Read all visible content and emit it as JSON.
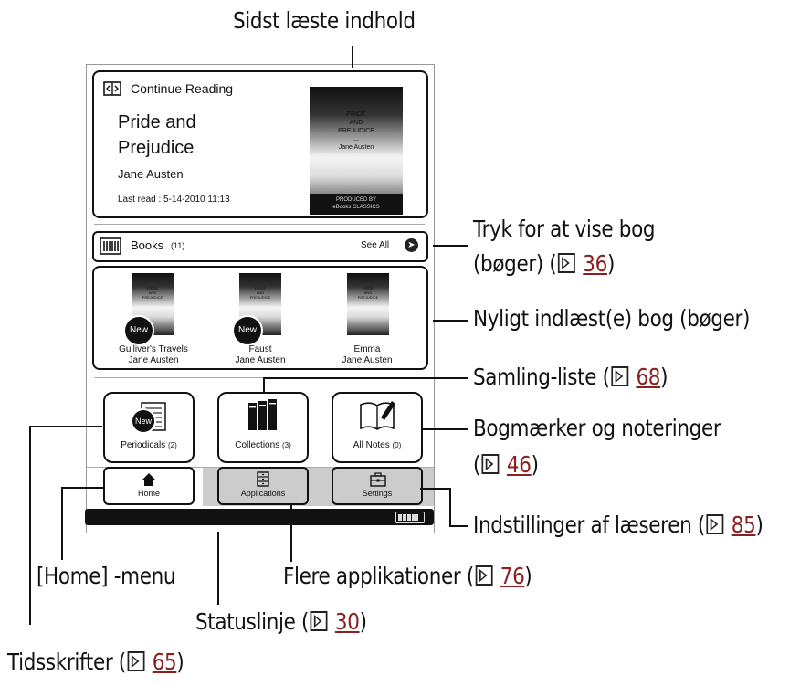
{
  "callouts": {
    "recent_content": "Sidst læste indhold",
    "tap_books_a": "Tryk for at vise bog",
    "tap_books_b": "(bøger) (",
    "tap_books_ref": "36",
    "new_books": "Nyligt indlæst(e) bog (bøger)",
    "collection_list": "Samling-liste (",
    "collection_ref": "68",
    "bookmarks_a": "Bogmærker og noteringer",
    "bookmarks_b": "(",
    "bookmarks_ref": "46",
    "settings": "Indstillinger af læseren (",
    "settings_ref": "85",
    "home_menu": "[Home] -menu",
    "more_apps": "Flere applikationer (",
    "more_apps_ref": "76",
    "status_line": "Statuslinje (",
    "status_ref": "30",
    "periodicals": "Tidsskrifter (",
    "periodicals_ref": "65",
    "close_paren": ")"
  },
  "continue_reading": {
    "label": "Continue Reading",
    "title_line1": "Pride and",
    "title_line2": "Prejudice",
    "author": "Jane Austen",
    "last_read": "Last read : 5-14-2010 11:13",
    "cover_lines": [
      "PRIDE",
      "AND",
      "PREJUDICE",
      "...",
      "Jane Austen"
    ],
    "cover_footer_1": "PRODUCED BY",
    "cover_footer_2": "eBooks CLASSICS"
  },
  "books_bar": {
    "label": "Books",
    "count": "(11)",
    "see_all": "See All"
  },
  "recent_books": [
    {
      "title": "Gulliver's Travels",
      "author": "Jane Austen",
      "badge": "New"
    },
    {
      "title": "Faust",
      "author": "Jane Austen",
      "badge": "New"
    },
    {
      "title": "Emma",
      "author": "Jane Austen",
      "badge": ""
    }
  ],
  "mini_cover_lines": [
    "PRIDE",
    "AND",
    "PREJUDICE",
    "...",
    "Jane Austen"
  ],
  "icon_buttons": {
    "periodicals_label": "Periodicals",
    "periodicals_count": "(2)",
    "periodicals_badge": "New",
    "collections_label": "Collections",
    "collections_count": "(3)",
    "notes_label": "All Notes",
    "notes_count": "(0)"
  },
  "tabs": {
    "home": "Home",
    "applications": "Applications",
    "settings": "Settings"
  }
}
